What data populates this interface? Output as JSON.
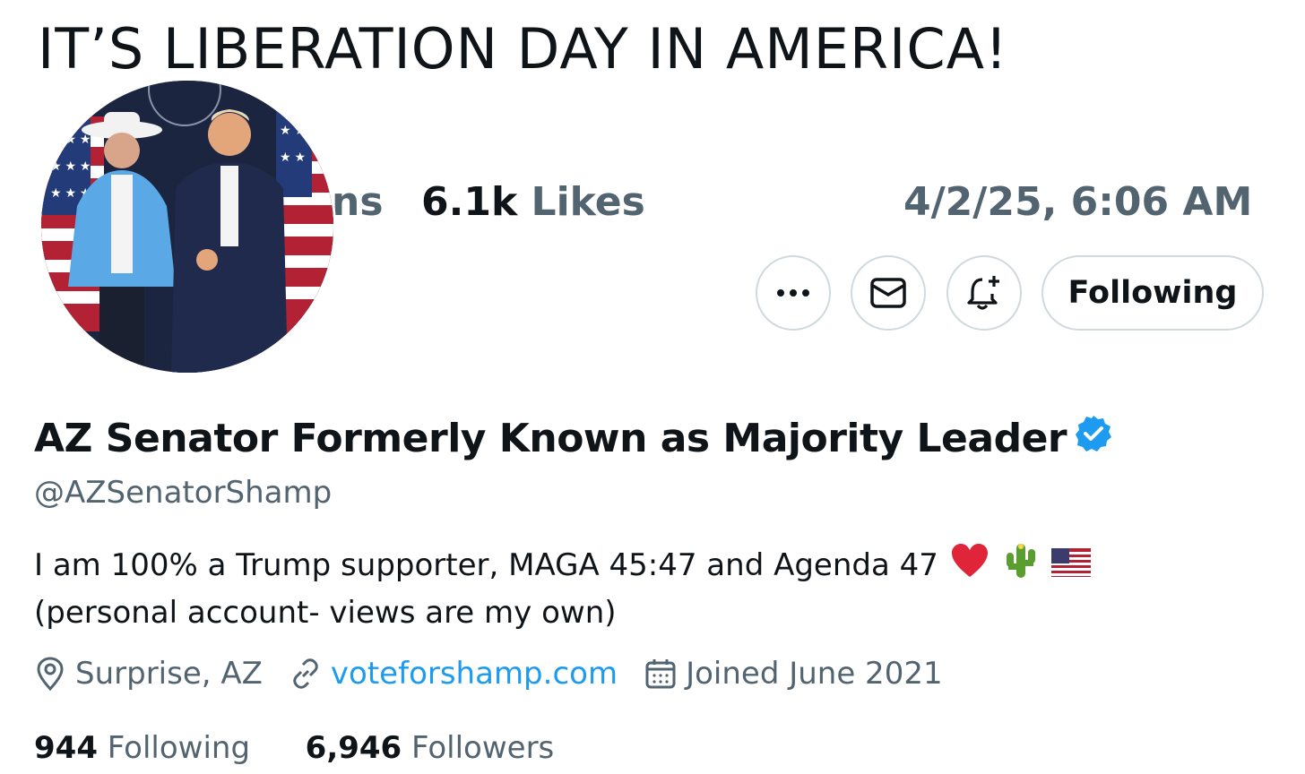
{
  "banner": {
    "title": "IT’S LIBERATION DAY IN AMERICA!"
  },
  "post_stats": {
    "partial_label": "ns",
    "likes_count": "6.1k",
    "likes_label": "Likes",
    "timestamp": "4/2/25, 6:06 AM"
  },
  "profile": {
    "avatar_icon": "profile-avatar",
    "actions": {
      "more_icon": "more-icon",
      "message_icon": "mail-icon",
      "notify_icon": "bell-plus-icon",
      "follow_label": "Following"
    },
    "display_name": "AZ Senator Formerly Known as Majority Leader",
    "verified_color": "#1d9bf0",
    "handle": "@AZSenatorShamp",
    "bio_part1": "I am 100% a Trump supporter, MAGA 45:47 and Agenda 47",
    "bio_emojis": [
      "heart-emoji",
      "cactus-emoji",
      "us-flag-emoji"
    ],
    "bio_part2": "(personal account- views are my own)",
    "location": "Surprise, AZ",
    "website": "voteforshamp.com",
    "joined": "Joined June 2021",
    "following_count": "944",
    "following_label": "Following",
    "followers_count": "6,946",
    "followers_label": "Followers"
  },
  "colors": {
    "accent": "#1d9bf0",
    "secondary_text": "#536471",
    "primary_text": "#0f1419",
    "border": "#cfd9de"
  }
}
